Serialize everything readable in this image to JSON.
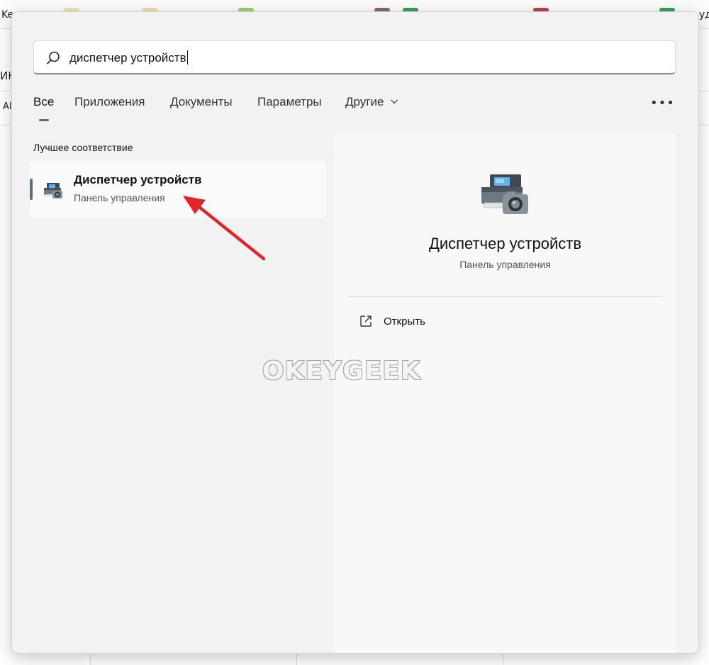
{
  "search": {
    "query": "диспетчер устройств"
  },
  "tabs": [
    {
      "label": "Все",
      "active": true
    },
    {
      "label": "Приложения"
    },
    {
      "label": "Документы"
    },
    {
      "label": "Параметры"
    },
    {
      "label": "Другие"
    }
  ],
  "more_label": "•••",
  "best_match": {
    "heading": "Лучшее соответствие",
    "title": "Диспетчер устройств",
    "subtitle": "Панель управления",
    "icon": "device-manager-icon"
  },
  "detail": {
    "title": "Диспетчер устройств",
    "subtitle": "Панель управления",
    "icon": "device-manager-icon",
    "actions": [
      {
        "label": "Открыть",
        "icon": "open-external-icon"
      }
    ]
  },
  "background_fragments": [
    "Ke",
    "уд",
    "ИНС",
    "Al"
  ],
  "watermark": "OKEYGEEK",
  "colors": {
    "accent": "#5b6f7a",
    "annotation_arrow": "#e0262b",
    "flyout_bg": "#f2f2f2"
  }
}
